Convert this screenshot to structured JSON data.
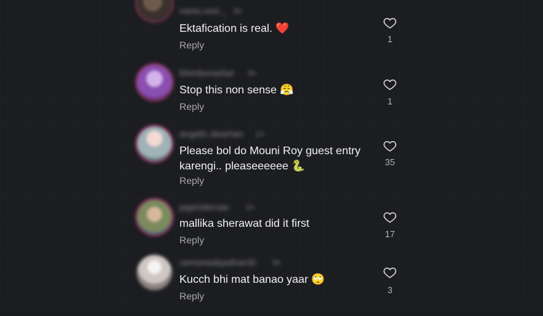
{
  "comments": [
    {
      "username": "vaniu.xxxi._",
      "time": "3h",
      "text": "Ektafication is real.",
      "emoji": "❤️",
      "reply": "Reply",
      "likes": "1"
    },
    {
      "username": "bhimborashar",
      "time": "3h",
      "text": "Stop this non sense",
      "emoji": "😤",
      "reply": "Reply",
      "likes": "1"
    },
    {
      "username": "angelic.dearhan",
      "time": "1h",
      "text": "Please bol do Mouni Roy guest entry karengi.. pleaseeeeee",
      "emoji": "🐍",
      "reply": "Reply",
      "likes": "35"
    },
    {
      "username": "jagenderraw",
      "time": "1h",
      "text": "mallika sherawat did it first",
      "emoji": "",
      "reply": "Reply",
      "likes": "17"
    },
    {
      "username": "ramsewakpatharri0",
      "time": "3h",
      "text": "Kucch bhi mat banao yaar",
      "emoji": "🙄",
      "reply": "Reply",
      "likes": "3"
    }
  ],
  "colors": {
    "background": "#1c1d21",
    "text": "#f3f3f3",
    "muted": "#a8a8ad",
    "heart_stroke": "#d9d9de",
    "heart_emoji": "#e53935"
  },
  "icons": {
    "like": "heart-outline-icon"
  }
}
